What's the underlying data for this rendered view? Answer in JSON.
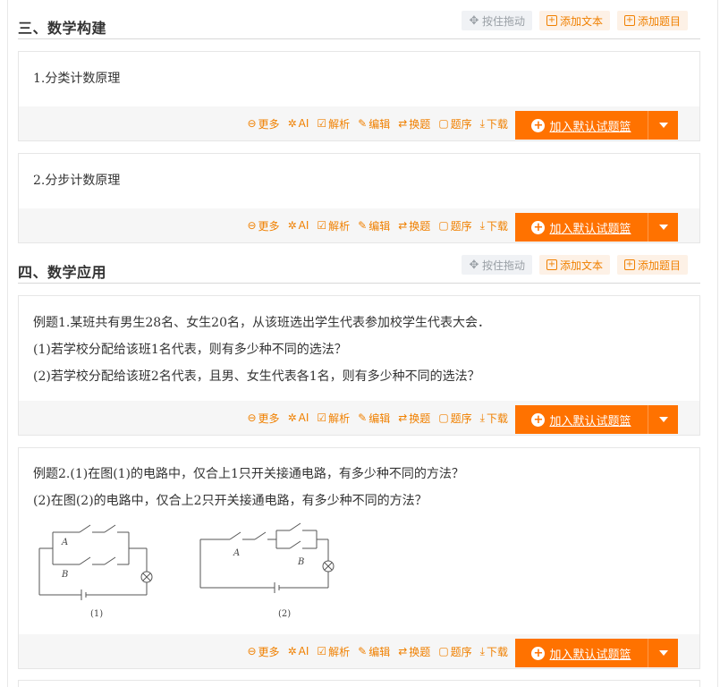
{
  "sections": [
    {
      "title": "三、数学构建",
      "buttons": {
        "drag": "按住拖动",
        "add_text": "添加文本",
        "add_question": "添加题目"
      }
    },
    {
      "title": "四、数学应用",
      "buttons": {
        "drag": "按住拖动",
        "add_text": "添加文本",
        "add_question": "添加题目"
      }
    }
  ],
  "actions": {
    "more": "更多",
    "ai": "AI",
    "analysis": "解析",
    "edit": "编辑",
    "swap": "换题",
    "order": "题序",
    "download": "下载"
  },
  "add_basket_label": "加入默认试题篮",
  "questions": [
    {
      "lines": [
        "1.分类计数原理"
      ]
    },
    {
      "lines": [
        "2.分步计数原理"
      ]
    },
    {
      "lines": [
        "例题1.某班共有男生28名、女生20名，从该班选出学生代表参加校学生代表大会．",
        "(1)若学校分配给该班1名代表，则有多少种不同的选法？",
        "(2)若学校分配给该班2名代表，且男、女生代表各1名，则有多少种不同的选法？"
      ]
    },
    {
      "lines": [
        "例题2.(1)在图(1)的电路中，仅合上1只开关接通电路，有多少种不同的方法？",
        "(2)在图(2)的电路中，仅合上2只开关接通电路，有多少种不同的方法？"
      ],
      "figure": {
        "left_labels": [
          "A",
          "B"
        ],
        "left_caption": "(1)",
        "right_labels": [
          "A",
          "B"
        ],
        "right_caption": "(2)"
      }
    }
  ],
  "colors": {
    "accent": "#ff7200",
    "action_text": "#f08000",
    "foot_bg": "#f6f6f6"
  }
}
